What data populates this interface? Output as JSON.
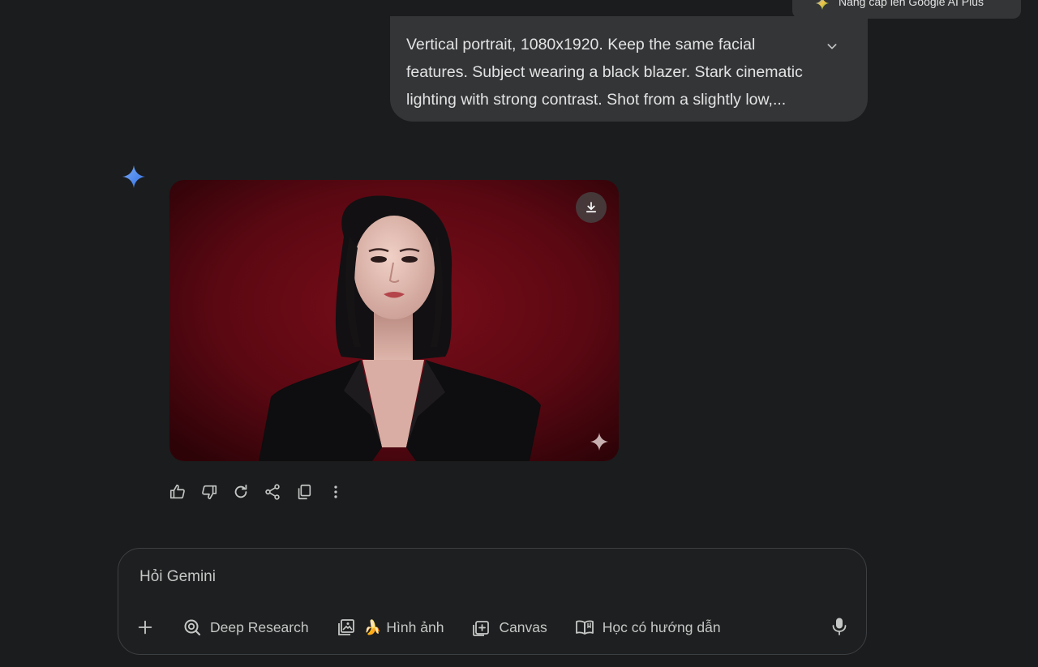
{
  "header": {
    "upgrade_label": "Nâng cấp lên Google AI Plus"
  },
  "user_message": {
    "text": "Vertical portrait, 1080x1920. Keep the same facial features. Subject wearing a black blazer. Stark cinematic lighting with strong contrast. Shot from a slightly low,..."
  },
  "icons": {
    "expand": "chevron-down-icon",
    "gemini": "gemini-sparkle-icon",
    "download": "download-icon",
    "watermark": "sparkle-icon"
  },
  "response_actions": [
    "thumbs-up-icon",
    "thumbs-down-icon",
    "redo-icon",
    "share-icon",
    "copy-icon",
    "more-vert-icon"
  ],
  "composer": {
    "placeholder": "Hỏi Gemini",
    "tools": {
      "deep_research": "Deep Research",
      "image_emoji": "🍌",
      "image": "Hình ảnh",
      "canvas": "Canvas",
      "guided_learning": "Học có hướng dẫn"
    }
  },
  "colors": {
    "background": "#1b1c1d",
    "bubble": "#333537",
    "gemini_blue": "#4285f4",
    "image_backdrop": "#6e0b16"
  }
}
